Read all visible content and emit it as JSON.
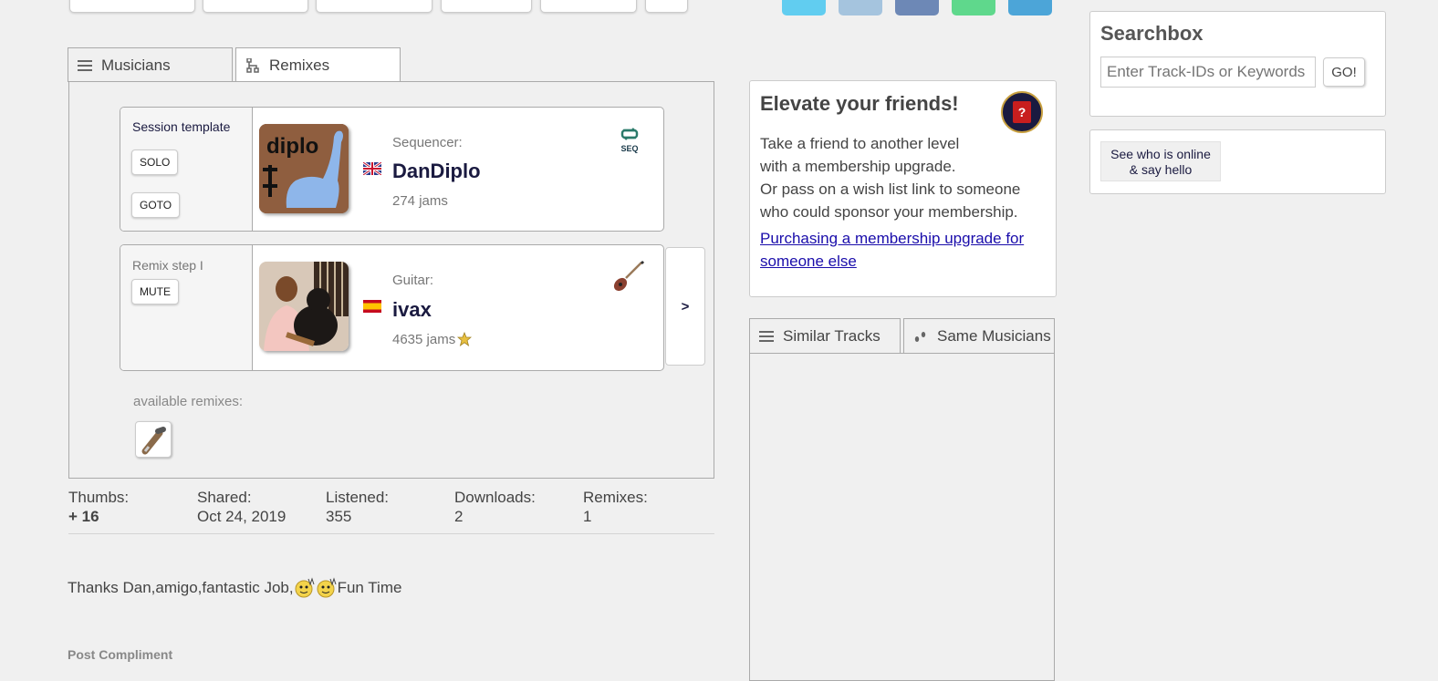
{
  "tabs": {
    "musicians_label": "Musicians",
    "remixes_label": "Remixes"
  },
  "tracks": [
    {
      "left_label": "Session template",
      "buttons": [
        "SOLO",
        "GOTO"
      ],
      "role": "Sequencer:",
      "name": "DanDiplo",
      "jams": "274 jams",
      "badge_text": "SEQ",
      "flag": "uk-flag",
      "avatar_text": "diplo"
    },
    {
      "left_label": "Remix step I",
      "buttons": [
        "MUTE"
      ],
      "role": "Guitar:",
      "name": "ivax",
      "jams": "4635 jams",
      "flag": "spain-flag",
      "next_label": ">"
    }
  ],
  "available_remixes_label": "available remixes:",
  "stats": [
    {
      "label": "Thumbs:",
      "value": "+ 16"
    },
    {
      "label": "Shared:",
      "value": "Oct 24, 2019"
    },
    {
      "label": "Listened:",
      "value": "355"
    },
    {
      "label": "Downloads:",
      "value": "2"
    },
    {
      "label": "Remixes:",
      "value": "1"
    }
  ],
  "comment": {
    "text_before": "Thanks Dan,amigo,fantastic Job,",
    "text_after": " Fun Time"
  },
  "post_compliment_label": "Post Compliment",
  "elevate": {
    "title": "Elevate your friends!",
    "line1": "Take a friend to another level",
    "line2": "with a membership upgrade.",
    "line3": "Or pass on a wish list link to someone",
    "line4": "who could sponsor your membership.",
    "link": "Purchasing a membership upgrade for someone else",
    "help_icon": "?"
  },
  "similar_tabs": {
    "similar_label": "Similar Tracks",
    "same_label": "Same Musicians"
  },
  "searchbox": {
    "title": "Searchbox",
    "placeholder": "Enter Track-IDs or Keywords",
    "go_label": "GO!"
  },
  "online": {
    "label_line1": "See who is online",
    "label_line2": "& say hello"
  },
  "colors": {
    "twitter": "#61cdf0",
    "share2": "#a5c4de",
    "facebook": "#6d88b6",
    "whatsapp": "#5fd88c",
    "telegram": "#4ca5d8"
  }
}
